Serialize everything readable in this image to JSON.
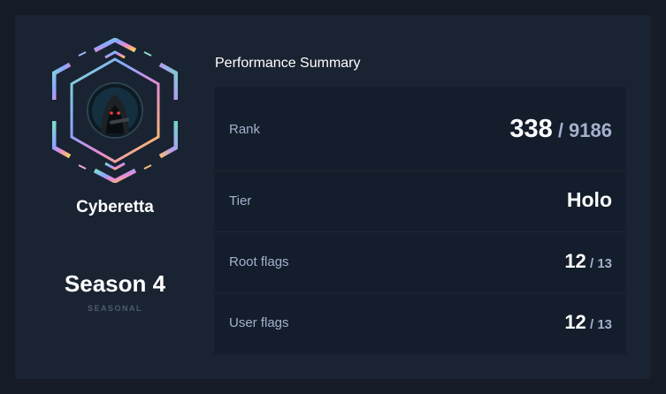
{
  "profile": {
    "username": "Cyberetta",
    "season_title": "Season 4",
    "season_subtitle": "SEASONAL",
    "avatar_icon": "hooded-figure-icon",
    "badge_icon": "hexagon-rank-badge-icon",
    "badge_gradient": [
      "#7ee0c8",
      "#8aa6ff",
      "#e48ad8",
      "#f6b17e",
      "#f3d36a"
    ]
  },
  "summary": {
    "title": "Performance Summary",
    "rows": [
      {
        "label": "Rank",
        "value": "338",
        "separator": " / ",
        "total": "9186"
      },
      {
        "label": "Tier",
        "value": "Holo"
      },
      {
        "label": "Root flags",
        "value": "12",
        "separator": " / ",
        "total": "13"
      },
      {
        "label": "User flags",
        "value": "12",
        "separator": " / ",
        "total": "13"
      }
    ]
  },
  "colors": {
    "background": "#151c27",
    "card": "#1a2332",
    "panel": "#141d2b",
    "label": "#a4b1cd",
    "value": "#ffffff"
  }
}
